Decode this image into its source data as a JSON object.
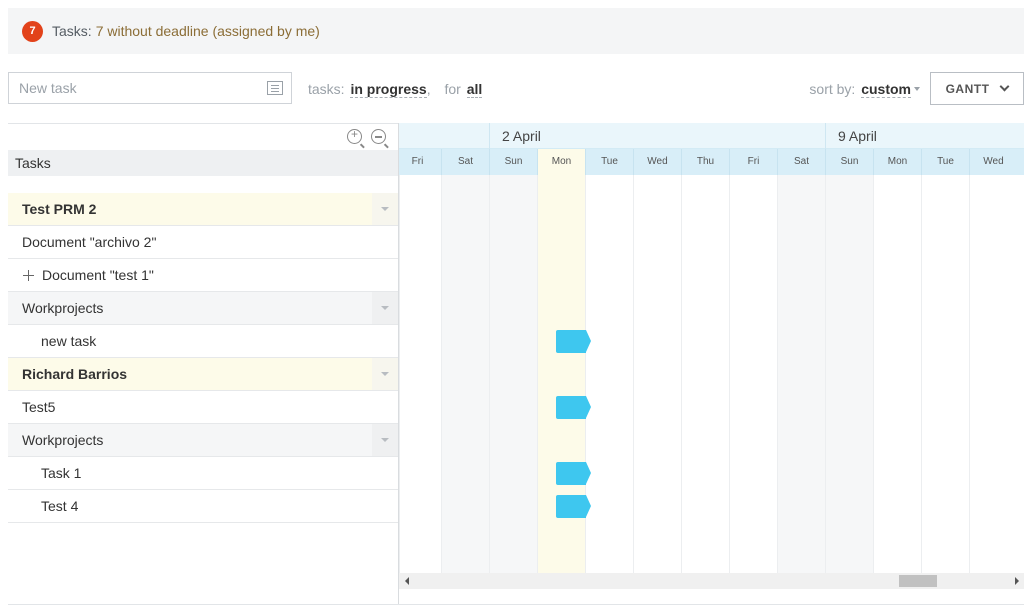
{
  "notice": {
    "count": "7",
    "label": "Tasks:",
    "link": "7 without deadline (assigned by me)"
  },
  "toolbar": {
    "new_task_placeholder": "New task",
    "filter_tasks_label": "tasks:",
    "filter_tasks_value": "in progress",
    "filter_sep": ",",
    "filter_for_label": "for",
    "filter_for_value": "all",
    "sort_label": "sort by:",
    "sort_value": "custom",
    "view_label": "GANTT"
  },
  "tasks_panel": {
    "header": "Tasks",
    "rows": [
      {
        "label": "Test PRM 2",
        "kind": "project"
      },
      {
        "label": "Document \"archivo 2\"",
        "kind": "task"
      },
      {
        "label": "Document \"test 1\"",
        "kind": "task-expandable"
      },
      {
        "label": "Workprojects",
        "kind": "section"
      },
      {
        "label": "new task",
        "kind": "subtask"
      },
      {
        "label": "Richard Barrios",
        "kind": "project"
      },
      {
        "label": "Test5",
        "kind": "task"
      },
      {
        "label": "Workprojects",
        "kind": "section"
      },
      {
        "label": "Task 1",
        "kind": "subtask"
      },
      {
        "label": "Test 4",
        "kind": "subtask"
      }
    ]
  },
  "gantt": {
    "weeks": [
      "2 April",
      "9 April"
    ],
    "days": [
      "Fri",
      "Sat",
      "Sun",
      "Mon",
      "Tue",
      "Wed",
      "Thu",
      "Fri",
      "Sat",
      "Sun",
      "Mon",
      "Tue",
      "Wed"
    ],
    "today_day": "Mon",
    "bar_color": "#3ec7ef",
    "bars_on_rows": [
      "new task",
      "Test5",
      "Task 1",
      "Test 4"
    ]
  },
  "colors": {
    "badge": "#e2421a",
    "project_row": "#fdfbe9",
    "gantt_header": "#d8eef8"
  }
}
